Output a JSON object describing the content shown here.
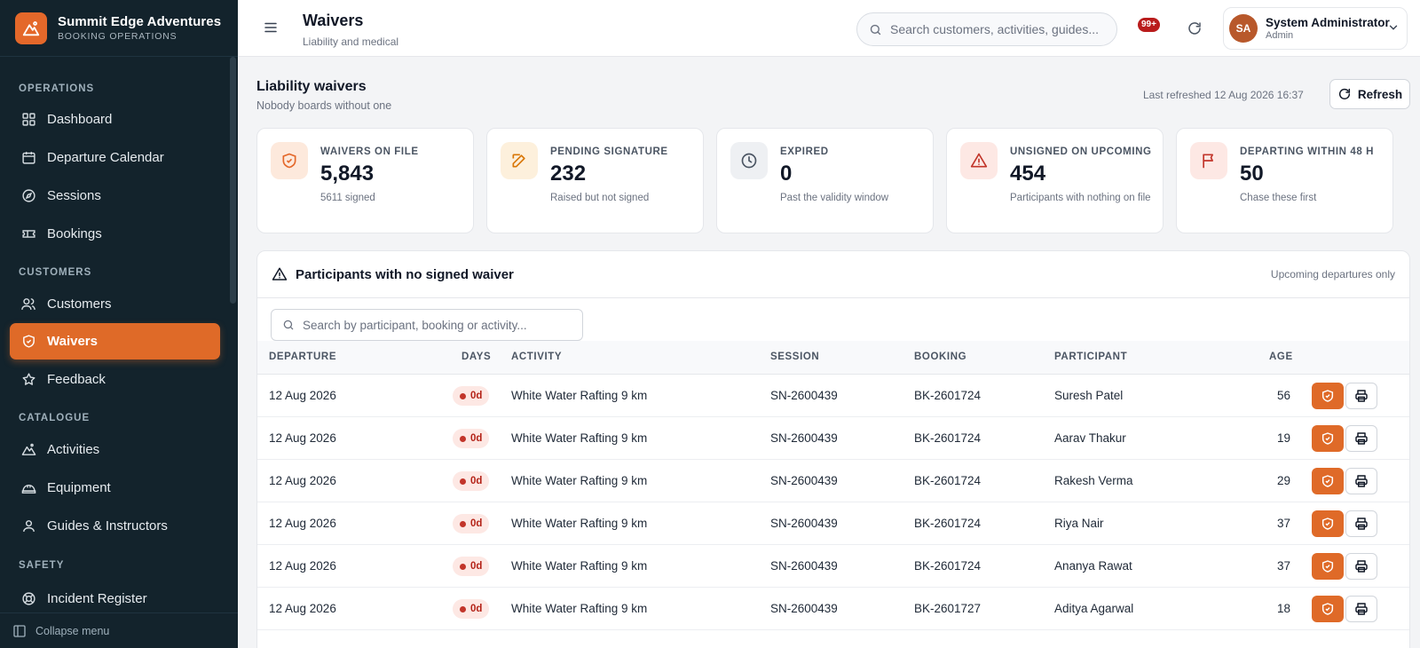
{
  "brand": {
    "name": "Summit Edge Adventures",
    "subtitle": "BOOKING OPERATIONS"
  },
  "sidebar": {
    "sections": [
      {
        "label": "OPERATIONS"
      },
      {
        "label": "CUSTOMERS"
      },
      {
        "label": "CATALOGUE"
      },
      {
        "label": "SAFETY"
      }
    ],
    "items": [
      {
        "label": "Dashboard",
        "icon": "grid-icon"
      },
      {
        "label": "Departure Calendar",
        "icon": "calendar-icon"
      },
      {
        "label": "Sessions",
        "icon": "compass-icon"
      },
      {
        "label": "Bookings",
        "icon": "ticket-icon"
      },
      {
        "label": "Customers",
        "icon": "users-icon"
      },
      {
        "label": "Waivers",
        "icon": "shield-icon",
        "active": true
      },
      {
        "label": "Feedback",
        "icon": "star-icon"
      },
      {
        "label": "Activities",
        "icon": "mountain-icon"
      },
      {
        "label": "Equipment",
        "icon": "helmet-icon"
      },
      {
        "label": "Guides & Instructors",
        "icon": "user-icon"
      },
      {
        "label": "Incident Register",
        "icon": "lifebuoy-icon"
      }
    ],
    "collapse_label": "Collapse menu"
  },
  "header": {
    "title": "Waivers",
    "subtitle": "Liability and medical",
    "search_placeholder": "Search customers, activities, guides...",
    "notification_count": "99+",
    "user": {
      "initials": "SA",
      "name": "System Administrator",
      "role": "Admin"
    }
  },
  "main": {
    "title": "Liability waivers",
    "subtitle": "Nobody boards without one",
    "last_refreshed": "Last refreshed 12 Aug 2026 16:37",
    "refresh_label": "Refresh",
    "stats": [
      {
        "label": "WAIVERS ON FILE",
        "value": "5,843",
        "note": "5611 signed",
        "icon": "shield-check-icon",
        "color": "#e4682a"
      },
      {
        "label": "PENDING SIGNATURE",
        "value": "232",
        "note": "Raised but not signed",
        "icon": "edit-icon",
        "color": "#d97706"
      },
      {
        "label": "EXPIRED",
        "value": "0",
        "note": "Past the validity window",
        "icon": "clock-icon",
        "color": "#4b5563"
      },
      {
        "label": "UNSIGNED ON UPCOMING",
        "value": "454",
        "note": "Participants with nothing on file",
        "icon": "warning-icon",
        "color": "#c2352a"
      },
      {
        "label": "DEPARTING WITHIN 48 H",
        "value": "50",
        "note": "Chase these first",
        "icon": "flag-icon",
        "color": "#c2352a"
      }
    ],
    "panel": {
      "title": "Participants with no signed waiver",
      "note": "Upcoming departures only",
      "search_placeholder": "Search by participant, booking or activity...",
      "columns": [
        "DEPARTURE",
        "DAYS",
        "ACTIVITY",
        "SESSION",
        "BOOKING",
        "PARTICIPANT",
        "AGE"
      ],
      "rows": [
        {
          "departure": "12 Aug 2026",
          "days": "0d",
          "activity": "White Water Rafting 9 km",
          "session": "SN-2600439",
          "booking": "BK-2601724",
          "participant": "Suresh Patel",
          "age": "56"
        },
        {
          "departure": "12 Aug 2026",
          "days": "0d",
          "activity": "White Water Rafting 9 km",
          "session": "SN-2600439",
          "booking": "BK-2601724",
          "participant": "Aarav Thakur",
          "age": "19"
        },
        {
          "departure": "12 Aug 2026",
          "days": "0d",
          "activity": "White Water Rafting 9 km",
          "session": "SN-2600439",
          "booking": "BK-2601724",
          "participant": "Rakesh Verma",
          "age": "29"
        },
        {
          "departure": "12 Aug 2026",
          "days": "0d",
          "activity": "White Water Rafting 9 km",
          "session": "SN-2600439",
          "booking": "BK-2601724",
          "participant": "Riya Nair",
          "age": "37"
        },
        {
          "departure": "12 Aug 2026",
          "days": "0d",
          "activity": "White Water Rafting 9 km",
          "session": "SN-2600439",
          "booking": "BK-2601724",
          "participant": "Ananya Rawat",
          "age": "37"
        },
        {
          "departure": "12 Aug 2026",
          "days": "0d",
          "activity": "White Water Rafting 9 km",
          "session": "SN-2600439",
          "booking": "BK-2601727",
          "participant": "Aditya Agarwal",
          "age": "18"
        }
      ]
    }
  }
}
